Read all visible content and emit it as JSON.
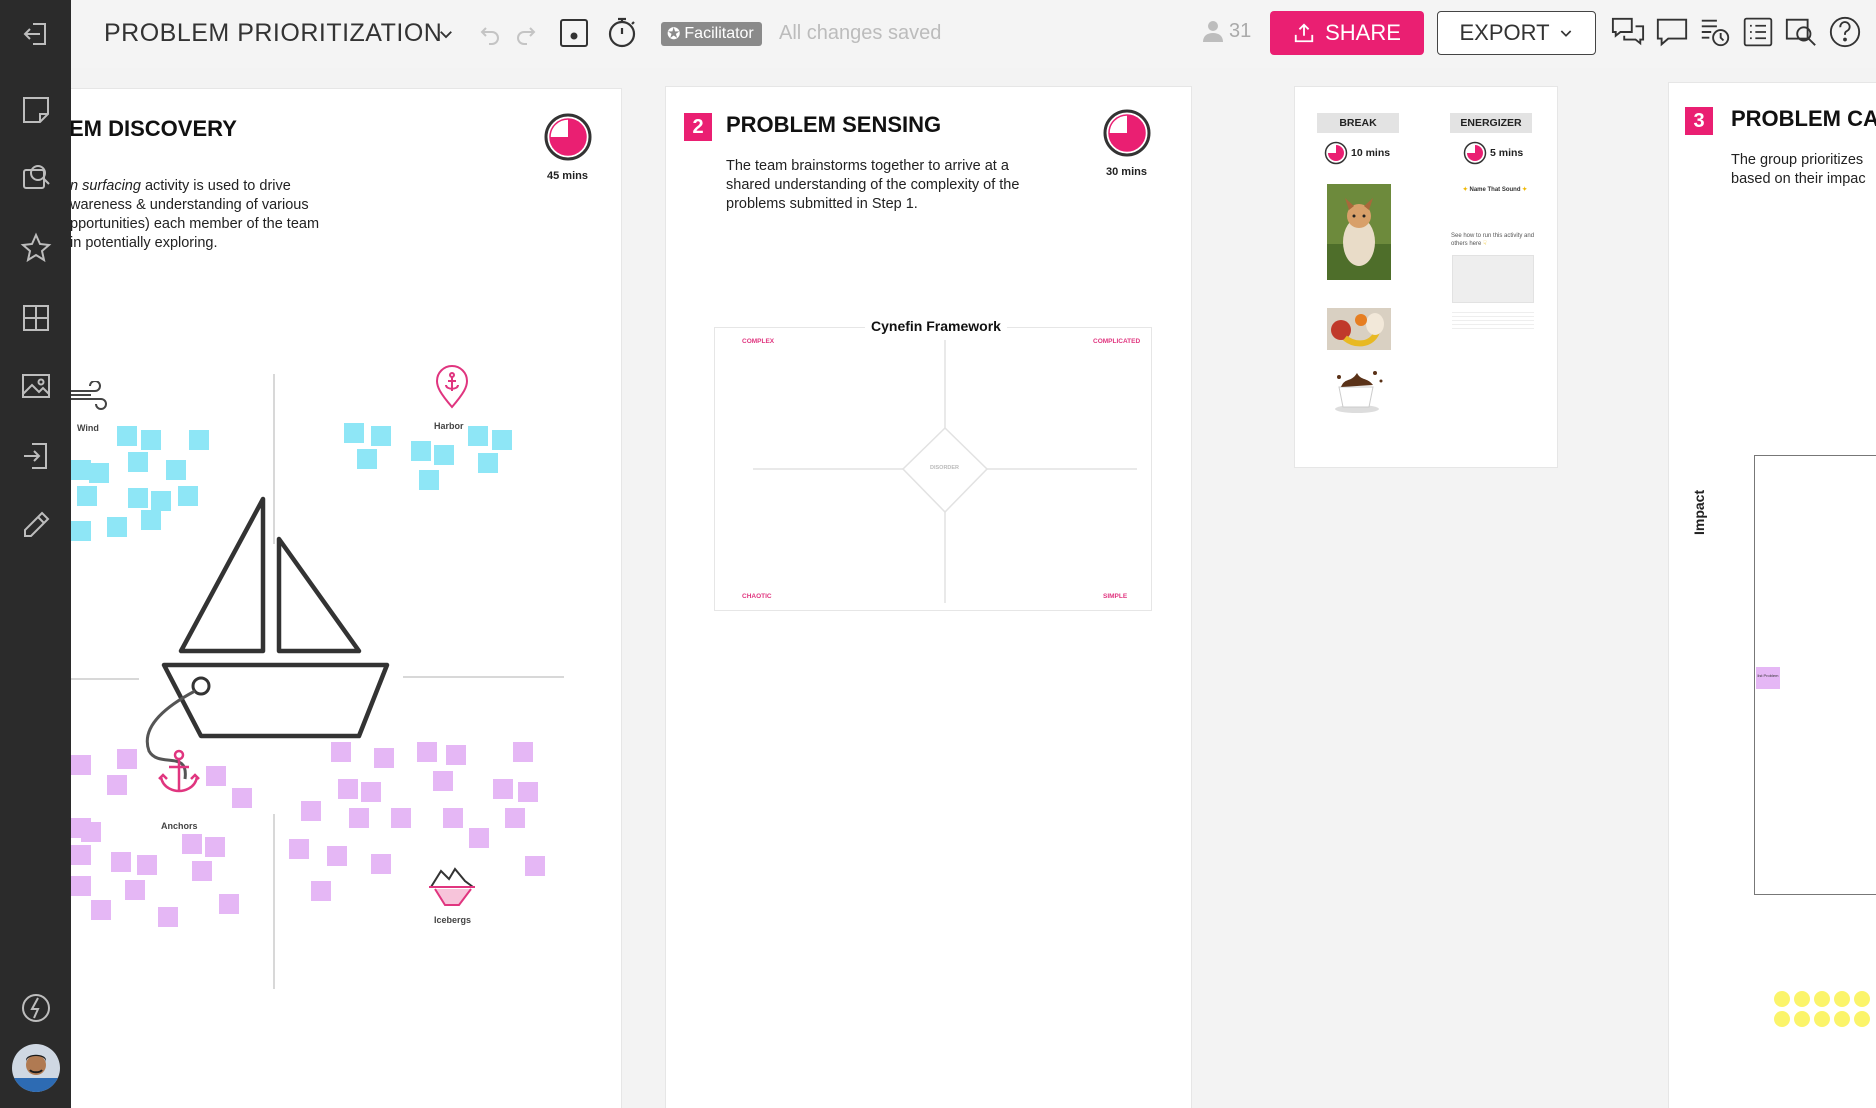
{
  "header": {
    "board_title": "PROBLEM PRIORITIZATION",
    "facilitator_label": "Facilitator",
    "save_status": "All changes saved",
    "user_count": "31",
    "share_label": "SHARE",
    "export_label": "EXPORT"
  },
  "colors": {
    "accent": "#ea1f72",
    "rail": "#2b2b2b",
    "sticky_cyan": "#8ee6f6",
    "sticky_lilac": "#e5b7f5",
    "sticky_yellow": "#fbf46a"
  },
  "rail_icons": [
    "exit-icon",
    "sticky-note-icon",
    "search-card-icon",
    "star-icon",
    "grid-icon",
    "image-icon",
    "import-icon",
    "pen-icon",
    "lightning-icon"
  ],
  "toolbar_icons": [
    "chevron-down-icon",
    "undo-icon",
    "redo-icon",
    "record-icon",
    "stopwatch-icon",
    "user-icon",
    "upload-icon",
    "chat-icon",
    "comment-icon",
    "activity-icon",
    "list-icon",
    "find-icon",
    "help-icon"
  ],
  "step1": {
    "title": "EM DISCOVERY",
    "desc_line1_italic": "n surfacing",
    "desc_line1_rest": " activity is used to drive",
    "desc_line2": "wareness & understanding of various",
    "desc_line3": "pportunities) each member of the team",
    "desc_line4": " in potentially exploring.",
    "timer": "45 mins",
    "labels": {
      "wind": "Wind",
      "harbor": "Harbor",
      "anchors": "Anchors",
      "icebergs": "Icebergs"
    }
  },
  "step2": {
    "number": "2",
    "title": "PROBLEM SENSING",
    "desc": "The team brainstorms together to arrive at a shared understanding of the complexity of the problems submitted in Step 1.",
    "timer": "30 mins",
    "framework_title": "Cynefin Framework",
    "quadrants": {
      "complex": "COMPLEX",
      "complicated": "COMPLICATED",
      "chaotic": "CHAOTIC",
      "simple": "SIMPLE",
      "center": "DISORDER"
    }
  },
  "breaks": {
    "break_label": "BREAK",
    "break_timer": "10 mins",
    "energizer_label": "ENERGIZER",
    "energizer_timer": "5 mins",
    "energizer_name": "Name That Sound",
    "energizer_note": "See how to run this activity and others here"
  },
  "step3": {
    "number": "3",
    "title": "PROBLEM CA",
    "desc_line1": "The group prioritizes",
    "desc_line2": "based on their impac",
    "axis_label": "Impact",
    "sticky_text": "list Problem"
  }
}
